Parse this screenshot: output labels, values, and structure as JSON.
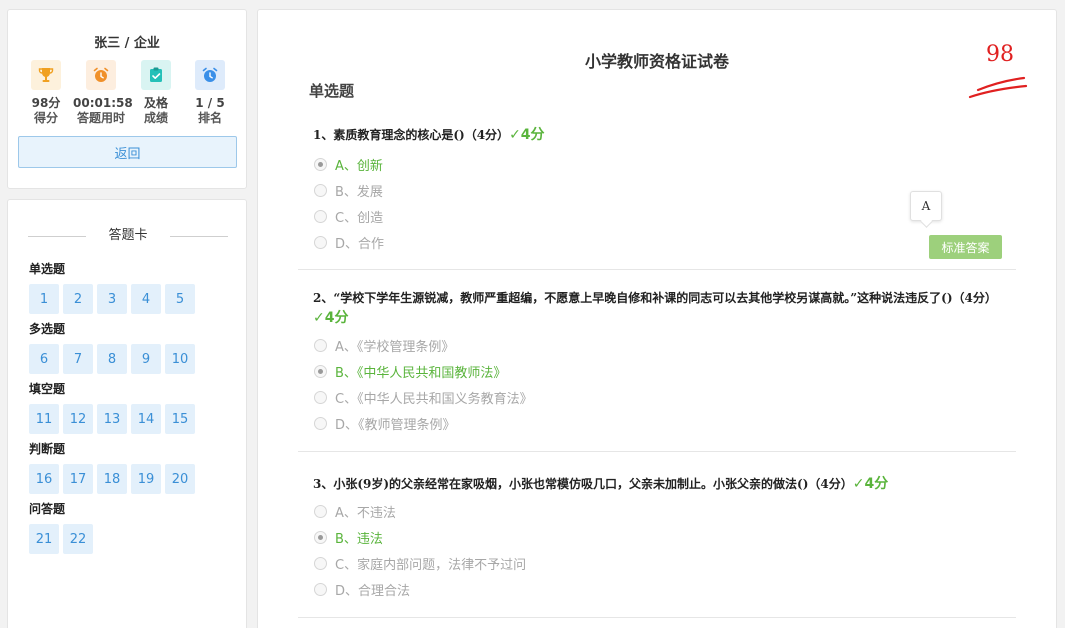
{
  "user": {
    "name": "张三 / 企业",
    "stats": [
      {
        "value": "98分",
        "label": "得分",
        "icon": "trophy-icon",
        "color": "#f0a020"
      },
      {
        "value": "00:01:58",
        "label": "答题用时",
        "icon": "alarm-clock-icon",
        "color": "#f0902a"
      },
      {
        "value": "及格",
        "label": "成绩",
        "icon": "clipboard-check-icon",
        "color": "#24c0b8"
      },
      {
        "value": "1 / 5",
        "label": "排名",
        "icon": "clock-icon",
        "color": "#3a8fe8"
      }
    ],
    "back_label": "返回"
  },
  "answer_card": {
    "title": "答题卡",
    "sections": [
      {
        "title": "单选题",
        "numbers": [
          "1",
          "2",
          "3",
          "4",
          "5"
        ]
      },
      {
        "title": "多选题",
        "numbers": [
          "6",
          "7",
          "8",
          "9",
          "10"
        ]
      },
      {
        "title": "填空题",
        "numbers": [
          "11",
          "12",
          "13",
          "14",
          "15"
        ]
      },
      {
        "title": "判断题",
        "numbers": [
          "16",
          "17",
          "18",
          "19",
          "20"
        ]
      },
      {
        "title": "问答题",
        "numbers": [
          "21",
          "22"
        ]
      }
    ]
  },
  "exam": {
    "title": "小学教师资格证试卷",
    "score": "98",
    "section_title": "单选题",
    "tooltip": "A",
    "standard_answer_label": "标准答案",
    "questions": [
      {
        "text": "1、素质教育理念的核心是()（4分）",
        "score": "✓4分",
        "options": [
          "A、创新",
          "B、发展",
          "C、创造",
          "D、合作"
        ],
        "selected": 0
      },
      {
        "text": "2、“学校下学年生源锐减，教师严重超编，不愿意上早晚自修和补课的同志可以去其他学校另谋高就。”这种说法违反了()（4分）",
        "score": "✓4分",
        "options": [
          "A、《学校管理条例》",
          "B、《中华人民共和国教师法》",
          "C、《中华人民共和国义务教育法》",
          "D、《教师管理条例》"
        ],
        "selected": 1
      },
      {
        "text": "3、小张(9岁)的父亲经常在家吸烟，小张也常模仿吸几口，父亲未加制止。小张父亲的做法()（4分）",
        "score": "✓4分",
        "options": [
          "A、不违法",
          "B、违法",
          "C、家庭内部问题，法律不予过问",
          "D、合理合法"
        ],
        "selected": 1
      }
    ]
  },
  "colors": {
    "accent_blue": "#3a8fd6",
    "correct_green": "#5ab43c",
    "score_red": "#e02020"
  }
}
